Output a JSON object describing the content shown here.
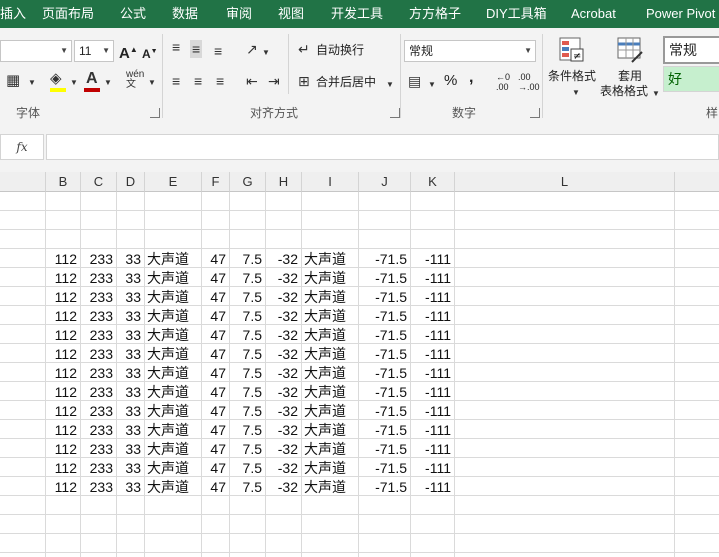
{
  "tabs": [
    "插入",
    "页面布局",
    "公式",
    "数据",
    "审阅",
    "视图",
    "开发工具",
    "方方格子",
    "DIY工具箱",
    "Acrobat",
    "Power Pivot"
  ],
  "font_group": {
    "font_size": "11",
    "grow_label": "A",
    "shrink_label": "A",
    "group_label": "字体"
  },
  "align_group": {
    "wrap_text_label": "自动换行",
    "merge_center_label": "合并后居中",
    "group_label": "对齐方式"
  },
  "number_group": {
    "format_value": "常规",
    "percent_label": "%",
    "comma_label": ",",
    "inc_decimal_label": ".00",
    "dec_decimal_label": ".00",
    "group_label": "数字"
  },
  "styles_group": {
    "conditional_format_label": "条件格式",
    "table_format_line1": "套用",
    "table_format_line2": "表格格式",
    "style_normal": "常规",
    "style_good": "好",
    "group_label": "样"
  },
  "formula_bar": {
    "fx_label": "fx",
    "content": ""
  },
  "columns": [
    "B",
    "C",
    "D",
    "E",
    "F",
    "G",
    "H",
    "I",
    "J",
    "K",
    "L"
  ],
  "rows": [
    [
      "112",
      "233",
      "33",
      "大声道",
      "47",
      "7.5",
      "-32",
      "大声道",
      "-71.5",
      "-111"
    ],
    [
      "112",
      "233",
      "33",
      "大声道",
      "47",
      "7.5",
      "-32",
      "大声道",
      "-71.5",
      "-111"
    ],
    [
      "112",
      "233",
      "33",
      "大声道",
      "47",
      "7.5",
      "-32",
      "大声道",
      "-71.5",
      "-111"
    ],
    [
      "112",
      "233",
      "33",
      "大声道",
      "47",
      "7.5",
      "-32",
      "大声道",
      "-71.5",
      "-111"
    ],
    [
      "112",
      "233",
      "33",
      "大声道",
      "47",
      "7.5",
      "-32",
      "大声道",
      "-71.5",
      "-111"
    ],
    [
      "112",
      "233",
      "33",
      "大声道",
      "47",
      "7.5",
      "-32",
      "大声道",
      "-71.5",
      "-111"
    ],
    [
      "112",
      "233",
      "33",
      "大声道",
      "47",
      "7.5",
      "-32",
      "大声道",
      "-71.5",
      "-111"
    ],
    [
      "112",
      "233",
      "33",
      "大声道",
      "47",
      "7.5",
      "-32",
      "大声道",
      "-71.5",
      "-111"
    ],
    [
      "112",
      "233",
      "33",
      "大声道",
      "47",
      "7.5",
      "-32",
      "大声道",
      "-71.5",
      "-111"
    ],
    [
      "112",
      "233",
      "33",
      "大声道",
      "47",
      "7.5",
      "-32",
      "大声道",
      "-71.5",
      "-111"
    ],
    [
      "112",
      "233",
      "33",
      "大声道",
      "47",
      "7.5",
      "-32",
      "大声道",
      "-71.5",
      "-111"
    ],
    [
      "112",
      "233",
      "33",
      "大声道",
      "47",
      "7.5",
      "-32",
      "大声道",
      "-71.5",
      "-111"
    ],
    [
      "112",
      "233",
      "33",
      "大声道",
      "47",
      "7.5",
      "-32",
      "大声道",
      "-71.5",
      "-111"
    ]
  ],
  "colors": {
    "ribbon_tab_bg": "#217346",
    "good_style_bg": "#c6efce",
    "good_style_fg": "#006100",
    "font_color_bar": "#c00000",
    "fill_color_bar": "#ffff00"
  }
}
